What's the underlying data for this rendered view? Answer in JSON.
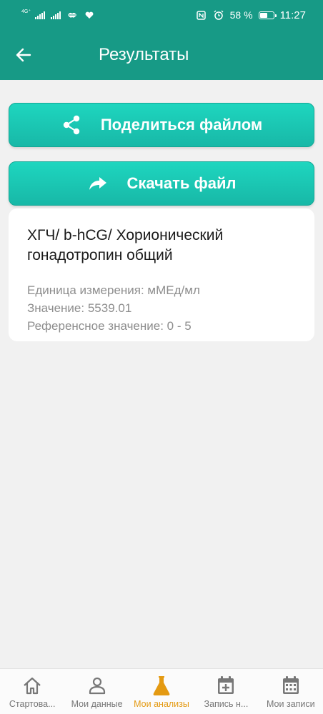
{
  "status_bar": {
    "network_label": "4G⁺",
    "battery": "58 %",
    "time": "11:27",
    "battery_level": 0.58
  },
  "header": {
    "title": "Результаты"
  },
  "actions": {
    "share_label": "Поделиться файлом",
    "download_label": "Скачать файл"
  },
  "result": {
    "title": "ХГЧ/ b-hCG/ Хорионический гонадотропин общий",
    "unit": "Единица измерения: мМЕд/мл",
    "value": "Значение: 5539.01",
    "reference": "Референсное значение: 0 - 5"
  },
  "bottom_nav": {
    "items": [
      {
        "label": "Стартова...",
        "icon": "home-icon"
      },
      {
        "label": "Мои данные",
        "icon": "person-icon"
      },
      {
        "label": "Мои анализы",
        "icon": "flask-icon"
      },
      {
        "label": "Запись н...",
        "icon": "calendar-plus-icon"
      },
      {
        "label": "Мои записи",
        "icon": "calendar-icon"
      }
    ],
    "active_index": 2
  },
  "colors": {
    "primary": "#179a86",
    "button": "#1ccab6",
    "active_nav": "#e49a12",
    "background": "#f1f1f1"
  }
}
